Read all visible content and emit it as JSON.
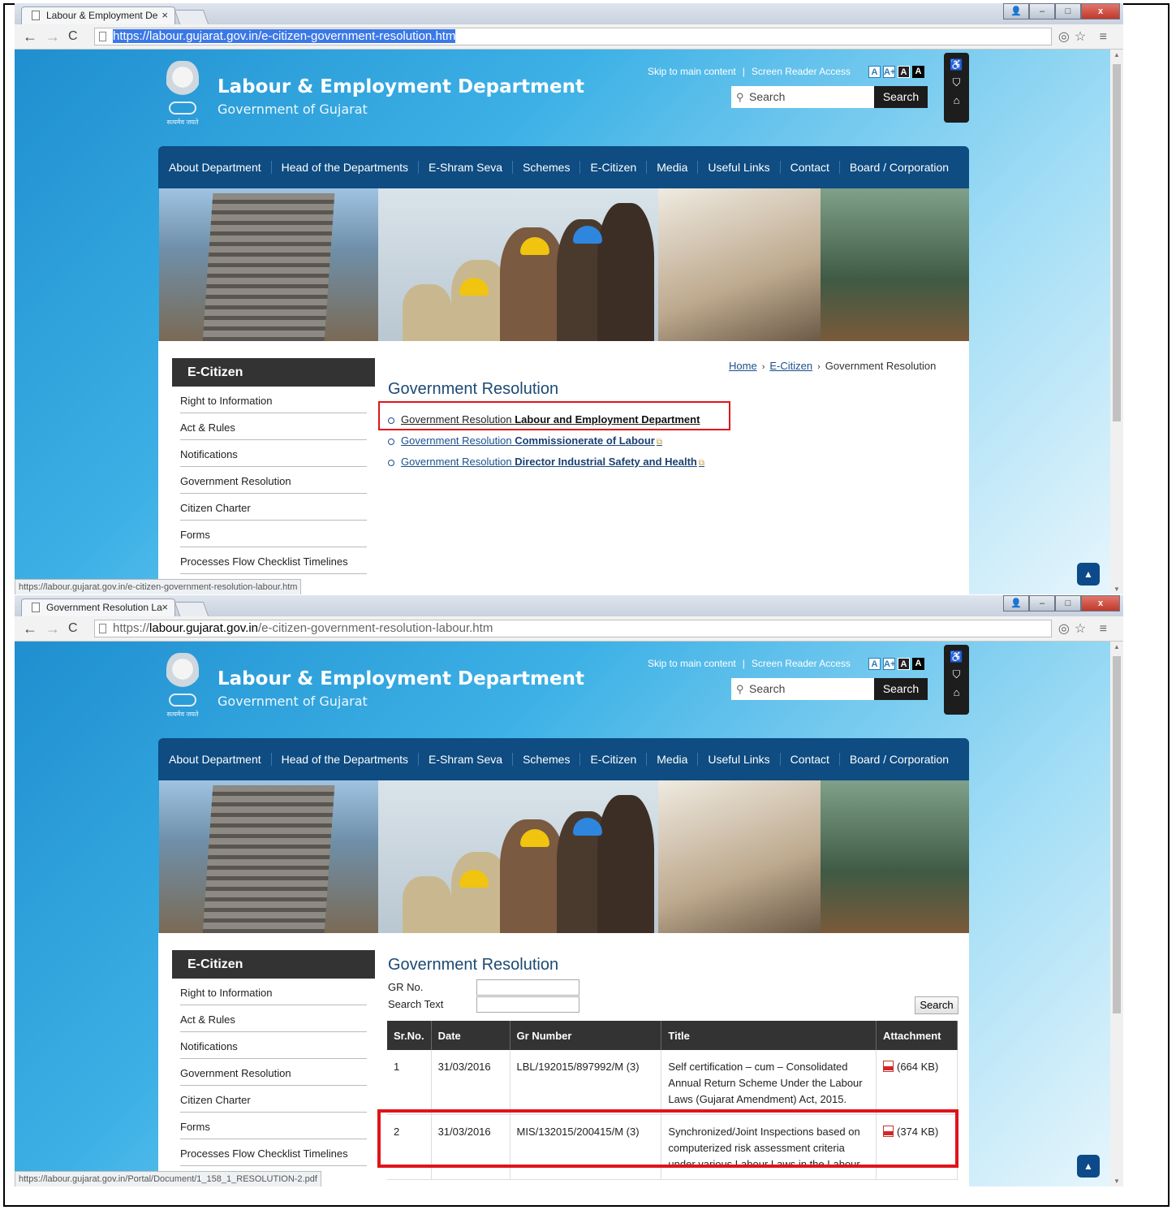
{
  "windows": [
    {
      "tab_title": "Labour & Employment De",
      "url_scheme": "https://",
      "url_host": "labour.gujarat.gov.in",
      "url_path": "/e-citizen-government-resolution.htm",
      "status_url": "https://labour.gujarat.gov.in/e-citizen-government-resolution-labour.htm"
    },
    {
      "tab_title": "Government Resolution La",
      "url_scheme": "https://",
      "url_host": "labour.gujarat.gov.in",
      "url_path": "/e-citizen-government-resolution-labour.htm",
      "status_url": "https://labour.gujarat.gov.in/Portal/Document/1_158_1_RESOLUTION-2.pdf"
    }
  ],
  "browser": {
    "tab_close": "×",
    "minimize": "–",
    "maximize": "□",
    "close": "x",
    "user": "👤",
    "back": "←",
    "forward": "→",
    "reload": "C",
    "shield_star_menu": "◎☆ ≡"
  },
  "header": {
    "emblem_motto": "सत्यमेव जयते",
    "title": "Labour & Employment Department",
    "subtitle": "Government of Gujarat",
    "skip_link": "Skip to main content",
    "separator": "|",
    "screen_reader": "Screen Reader Access",
    "font_sizes": [
      "A",
      "A+",
      "A",
      "A"
    ],
    "search_placeholder": "Search",
    "search_button": "Search",
    "side_icons": [
      "♿",
      "⛉",
      "⌂"
    ]
  },
  "mainnav": [
    "About Department",
    "Head of the Departments",
    "E-Shram Seva",
    "Schemes",
    "E-Citizen",
    "Media",
    "Useful Links",
    "Contact",
    "Board / Corporation"
  ],
  "sidebar": {
    "heading": "E-Citizen",
    "items": [
      "Right to Information",
      "Act & Rules",
      "Notifications",
      "Government Resolution",
      "Citizen Charter",
      "Forms",
      "Processes Flow Checklist Timelines"
    ]
  },
  "page1": {
    "breadcrumb": {
      "home": "Home",
      "ecitizen": "E-Citizen",
      "current": "Government Resolution",
      "sep": "›"
    },
    "title": "Government Resolution",
    "links": [
      {
        "prefix": "Government Resolution ",
        "bold": "Labour and Employment Department"
      },
      {
        "prefix": "Government Resolution ",
        "bold": "Commissionerate of Labour"
      },
      {
        "prefix": "Government Resolution ",
        "bold": "Director Industrial Safety and Health"
      }
    ],
    "ext_icon": "⧉"
  },
  "page2": {
    "title": "Government Resolution",
    "gr_no_label": "GR No.",
    "search_text_label": "Search Text",
    "search_button": "Search",
    "columns": [
      "Sr.No.",
      "Date",
      "Gr Number",
      "Title",
      "Attachment"
    ],
    "rows": [
      {
        "sr": "1",
        "date": "31/03/2016",
        "gr": "LBL/192015/897992/M (3)",
        "title": "Self certification – cum – Consolidated Annual Return Scheme Under the Labour Laws (Gujarat Amendment) Act, 2015.",
        "size": "(664 KB)"
      },
      {
        "sr": "2",
        "date": "31/03/2016",
        "gr": "MIS/132015/200415/M (3)",
        "title": "Synchronized/Joint Inspections based on computerized risk assessment criteria under various Labour Laws in the Labour",
        "size": "(374 KB)"
      }
    ]
  },
  "scroll_top_icon": "▲"
}
